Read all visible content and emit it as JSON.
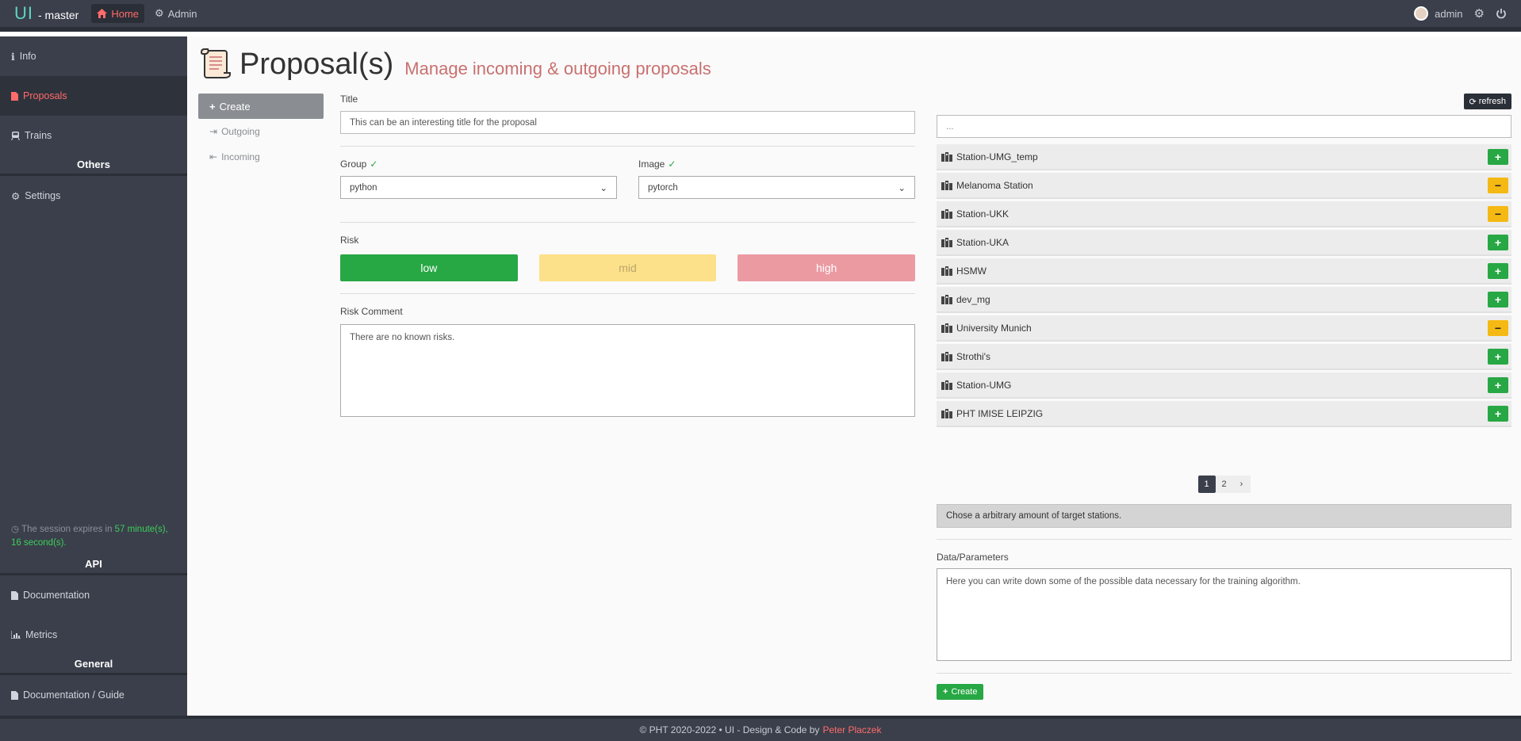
{
  "topbar": {
    "logo": "UI",
    "suffix": "- master",
    "nav": [
      {
        "label": "Home",
        "icon": "home-icon"
      },
      {
        "label": "Admin",
        "icon": "gear-icon"
      }
    ],
    "user": "admin"
  },
  "sidebar": {
    "items": [
      {
        "label": "Info",
        "icon": "info-icon"
      },
      {
        "label": "Proposals",
        "icon": "file-icon"
      },
      {
        "label": "Trains",
        "icon": "train-icon"
      }
    ],
    "others_heading": "Others",
    "others_items": [
      {
        "label": "Settings",
        "icon": "gear-icon"
      }
    ],
    "session_prefix": "The session expires in",
    "session_minutes": "57 minute(s),",
    "session_seconds": "16 second(s).",
    "api_heading": "API",
    "api_items": [
      {
        "label": "Documentation",
        "icon": "file-icon"
      },
      {
        "label": "Metrics",
        "icon": "chart-icon"
      }
    ],
    "general_heading": "General",
    "general_items": [
      {
        "label": "Documentation / Guide",
        "icon": "file-icon"
      }
    ]
  },
  "page": {
    "title": "Proposal(s)",
    "subtitle": "Manage incoming & outgoing proposals"
  },
  "subnav": {
    "create": "Create",
    "outgoing": "Outgoing",
    "incoming": "Incoming"
  },
  "form": {
    "title_label": "Title",
    "title_value": "This can be an interesting title for the proposal",
    "group_label": "Group",
    "group_value": "python",
    "image_label": "Image",
    "image_value": "pytorch",
    "risk_label": "Risk",
    "risk_low": "low",
    "risk_mid": "mid",
    "risk_high": "high",
    "risk_comment_label": "Risk Comment",
    "risk_comment_value": "There are no known risks."
  },
  "stations": {
    "refresh_label": "refresh",
    "search_placeholder": "...",
    "items": [
      {
        "name": "Station-UMG_temp",
        "action": "+"
      },
      {
        "name": "Melanoma Station",
        "action": "−"
      },
      {
        "name": "Station-UKK",
        "action": "−"
      },
      {
        "name": "Station-UKA",
        "action": "+"
      },
      {
        "name": "HSMW",
        "action": "+"
      },
      {
        "name": "dev_mg",
        "action": "+"
      },
      {
        "name": "University Munich",
        "action": "−"
      },
      {
        "name": "Strothi's",
        "action": "+"
      },
      {
        "name": "Station-UMG",
        "action": "+"
      },
      {
        "name": "PHT IMISE LEIPZIG",
        "action": "+"
      }
    ],
    "pages": [
      "1",
      "2"
    ],
    "hint": "Chose a arbitrary amount of target stations."
  },
  "data_params": {
    "label": "Data/Parameters",
    "value": "Here you can write down some of the possible data necessary for the training algorithm.",
    "create_label": "Create"
  },
  "footer": {
    "text": "© PHT 2020-2022 • UI - Design & Code by",
    "author": "Peter Placzek"
  },
  "colors": {
    "accent_red": "#ff6b6b",
    "success": "#28a745",
    "warning": "#f5b914",
    "dark": "#3a3f4b"
  }
}
